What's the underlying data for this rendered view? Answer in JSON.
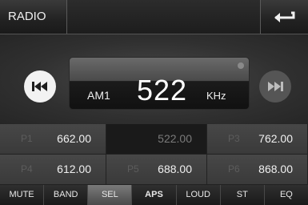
{
  "header": {
    "tab_label": "RADIO",
    "back_icon": "return-arrow-icon"
  },
  "display": {
    "band": "AM1",
    "frequency": "522",
    "unit": "KHz"
  },
  "controls": {
    "prev_icon": "seek-back-icon",
    "next_icon": "seek-forward-icon"
  },
  "presets": [
    {
      "label": "P1",
      "freq": "662.00",
      "selected": false
    },
    {
      "label": "P2",
      "freq": "522.00",
      "selected": true
    },
    {
      "label": "P3",
      "freq": "762.00",
      "selected": false
    },
    {
      "label": "P4",
      "freq": "612.00",
      "selected": false
    },
    {
      "label": "P5",
      "freq": "688.00",
      "selected": false
    },
    {
      "label": "P6",
      "freq": "868.00",
      "selected": false
    }
  ],
  "function_buttons": [
    {
      "label": "MUTE",
      "selected": false,
      "bold": false
    },
    {
      "label": "BAND",
      "selected": false,
      "bold": false
    },
    {
      "label": "SEL",
      "selected": true,
      "bold": false
    },
    {
      "label": "APS",
      "selected": false,
      "bold": true
    },
    {
      "label": "LOUD",
      "selected": false,
      "bold": false
    },
    {
      "label": "ST",
      "selected": false,
      "bold": false
    },
    {
      "label": "EQ",
      "selected": false,
      "bold": false
    }
  ],
  "colors": {
    "background": "#1b1b1b",
    "selected_preset": "#1a1a1a",
    "text": "#f0f0f0"
  }
}
